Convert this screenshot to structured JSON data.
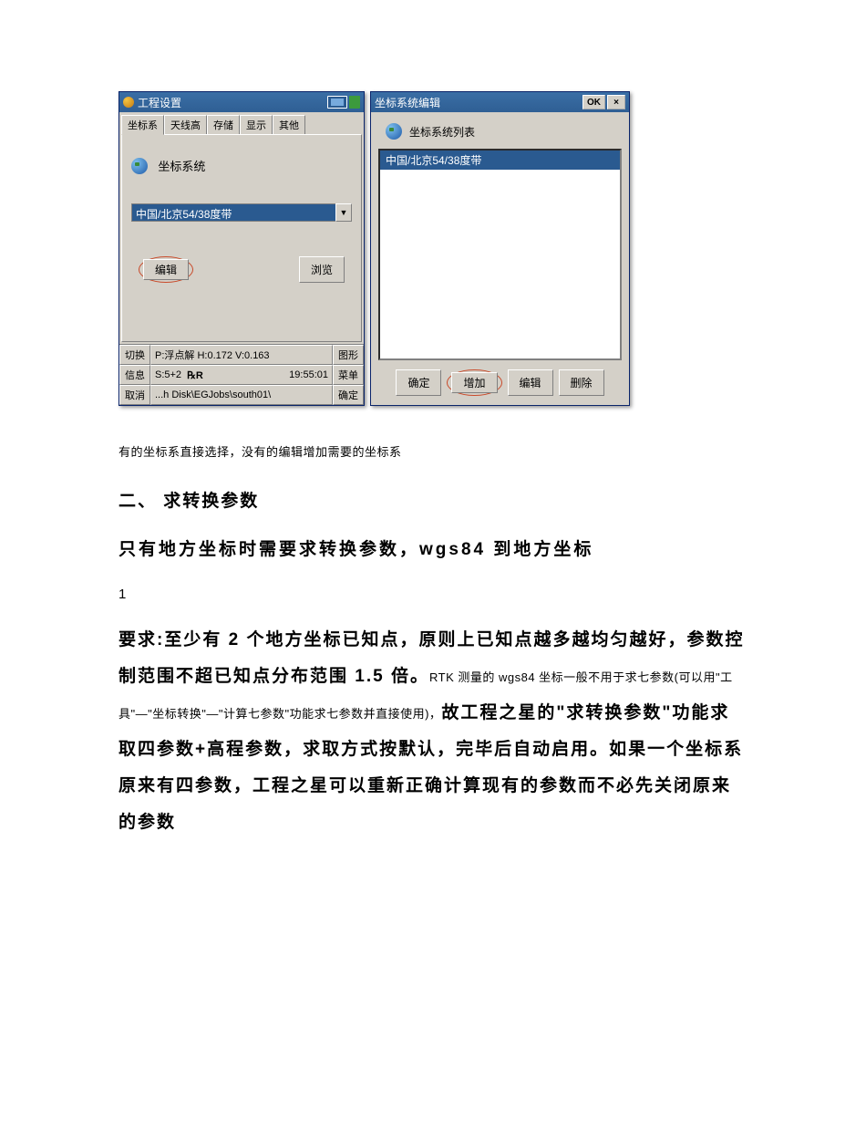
{
  "left_window": {
    "title": "工程设置",
    "tabs": [
      "坐标系",
      "天线高",
      "存储",
      "显示",
      "其他"
    ],
    "coord_system_label": "坐标系统",
    "combo_value": "中国/北京54/38度带",
    "btn_edit": "编辑",
    "btn_browse": "浏览",
    "status": {
      "r1_left": "切换",
      "r1_mid": "P:浮点解  H:0.172  V:0.163",
      "r1_right": "图形",
      "r2_left": "信息",
      "r2_mid_a": "S:5+2",
      "r2_mid_b": "℞R",
      "r2_mid_c": "19:55:01",
      "r2_right": "菜单",
      "r3_left": "取消",
      "r3_mid": "...h Disk\\EGJobs\\south01\\",
      "r3_right": "确定"
    }
  },
  "right_window": {
    "title": "坐标系统编辑",
    "btn_ok": "OK",
    "list_label": "坐标系统列表",
    "list_item": "中国/北京54/38度带",
    "btn_confirm": "确定",
    "btn_add": "增加",
    "btn_edit": "编辑",
    "btn_delete": "删除"
  },
  "doc": {
    "caption": "有的坐标系直接选择，没有的编辑增加需要的坐标系",
    "h2": "二、 求转换参数",
    "strong_line": "只有地方坐标时需要求转换参数，wgs84 到地方坐标",
    "line1": "1",
    "para_parts": {
      "p1_a": "要求:至少有 ",
      "p1_b": "2",
      "p1_c": " 个地方坐标已知点，原则上已知点越多越均匀越好，参数控制范围不超已知点分布范围 ",
      "p1_d": "1.5",
      "p1_e": " 倍。",
      "p1_small1": "RTK 测量的 wgs84 坐标一般不用于求七参数(可以用\"工具\"—\"坐标转换\"—\"计算七参数\"功能求七参数并直接使用)，",
      "p1_f": "故工程之星的\"求转换参数\"功能求取四参数+高程参数，求取方式按默认，完毕后自动启用。如果一个坐标系原来有四参数，工程之星可以重新正确计算现有的参数而不必先关闭原来的参数"
    }
  }
}
